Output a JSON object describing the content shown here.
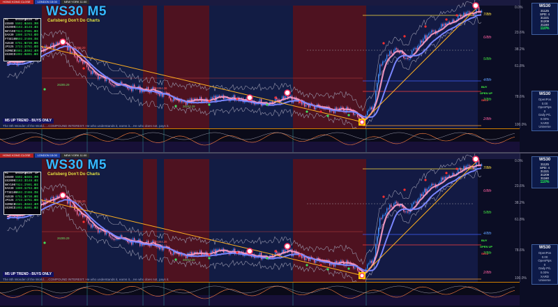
{
  "panels": [
    {
      "title": "WS30 M5",
      "subtitle": "Carlsberg Don't Do Charts",
      "sessions": [
        "HONG KONG CLOSE",
        "LONDON 15:00",
        "NEW YORK 11:00"
      ],
      "table": [
        [
          "M1",
          "NASDAQ",
          "WS30",
          "SP"
        ],
        [
          "US500",
          "5592.6",
          "5565.7",
          "RR"
        ],
        [
          "US2000",
          "2163.3",
          "2148.4",
          "EE"
        ],
        [
          "NKY100",
          "7924.1",
          "7901.6",
          "EE"
        ],
        [
          "DAX30",
          "1880.1",
          "1763.8",
          "DD"
        ],
        [
          "FTSE100",
          "7503.1",
          "7498.7",
          "DE"
        ],
        [
          "AUS30",
          "6751.5",
          "6730.6",
          "RE"
        ],
        [
          "JP225",
          "2723.1",
          "2751.6",
          "DD"
        ],
        [
          "SGMNCB",
          "5581.2",
          "5582.4",
          "ER"
        ],
        [
          "US30CD",
          "1002.0",
          "1001.8",
          "EE"
        ]
      ],
      "trend_label": "M5 UP TREND - BUYS ONLY",
      "motto": "The 8th Wonder of the World.....COMPOUND INTEREST. He who understands it, earns it....He who does not, pays it.",
      "eighths": [
        "7/8th",
        "6/8th",
        "5/8th",
        "4/8th",
        "3/8th",
        "2/8th"
      ],
      "percents": [
        "0.0%",
        "23.6%",
        "38.2%",
        "61.8%",
        "78.6%",
        "100.0%"
      ],
      "signals": {
        "buy": "BUY",
        "open_up": "OPEN UP",
        "sell": "SELL"
      },
      "price_labels": [
        "26395.20",
        "26364.36",
        "26285.29",
        "26244.29"
      ],
      "info": {
        "symbol": "WS30",
        "bid": "31125",
        "spread": "SPD: 4",
        "line1": "31321",
        "line2": "31209",
        "line3": "31160",
        "pct": "110%"
      },
      "info2": {
        "symbol": "WS30",
        "lines": [
          "OpenPos",
          "0.00",
          "OpenPips",
          "0",
          "Daily P/L",
          "0.00%",
          "XARD",
          "Universe"
        ]
      }
    },
    {
      "title": "WS30 M5",
      "subtitle": "Carlsberg Don't Do Charts",
      "sessions": [
        "HONG KONG CLOSE",
        "LONDON 15:00",
        "NEW YORK 11:00"
      ],
      "table": [
        [
          "M1",
          "NASDAQ",
          "WS30",
          "SP"
        ],
        [
          "US500",
          "5592.6",
          "5565.7",
          "RR"
        ],
        [
          "US2000",
          "2163.3",
          "2148.4",
          "EE"
        ],
        [
          "NKY100",
          "7924.1",
          "7901.6",
          "EE"
        ],
        [
          "DAX30",
          "1880.1",
          "1763.8",
          "DD"
        ],
        [
          "FTSE100",
          "7503.1",
          "7498.7",
          "DE"
        ],
        [
          "AUS30",
          "6751.5",
          "6730.6",
          "RE"
        ],
        [
          "JP225",
          "2723.1",
          "2751.6",
          "DD"
        ],
        [
          "SGMNCB",
          "5581.2",
          "5582.4",
          "ER"
        ],
        [
          "US30CD",
          "1002.0",
          "1001.8",
          "EE"
        ]
      ],
      "trend_label": "M5 UP TREND - BUYS ONLY",
      "motto": "The 8th Wonder of the World.....COMPOUND INTEREST. He who understands it, earns it....He who does not, pays it.",
      "eighths": [
        "7/8th",
        "6/8th",
        "5/8th",
        "4/8th",
        "3/8th",
        "2/8th"
      ],
      "percents": [
        "0.0%",
        "23.6%",
        "38.2%",
        "61.8%",
        "78.6%",
        "100.0%"
      ],
      "signals": {
        "buy": "BUY",
        "open_up": "OPEN UP",
        "sell": "SELL"
      },
      "price_labels": [
        "26395.20",
        "26364.36",
        "26285.29",
        "26244.29"
      ],
      "info": {
        "symbol": "WS30",
        "bid": "31125",
        "spread": "SPD: 4",
        "line1": "31321",
        "line2": "31209",
        "line3": "31160",
        "pct": "110%"
      },
      "info2": {
        "symbol": "WS30",
        "lines": [
          "OpenPos",
          "0.00",
          "OpenPips",
          "0",
          "Daily P/L",
          "0.00%",
          "XARD",
          "Universe"
        ]
      }
    }
  ],
  "colors": {
    "background": "#0b0d24",
    "bull_candle": "#3a8cff",
    "bear_candle": "#ff7ab0",
    "ma_fast": "#ff9ec8",
    "ma_slow": "#7a86ff",
    "trendline": "#ffb020",
    "zone_red": "#5a1420",
    "zone_blue": "#14204a",
    "title": "#35b8ff"
  }
}
